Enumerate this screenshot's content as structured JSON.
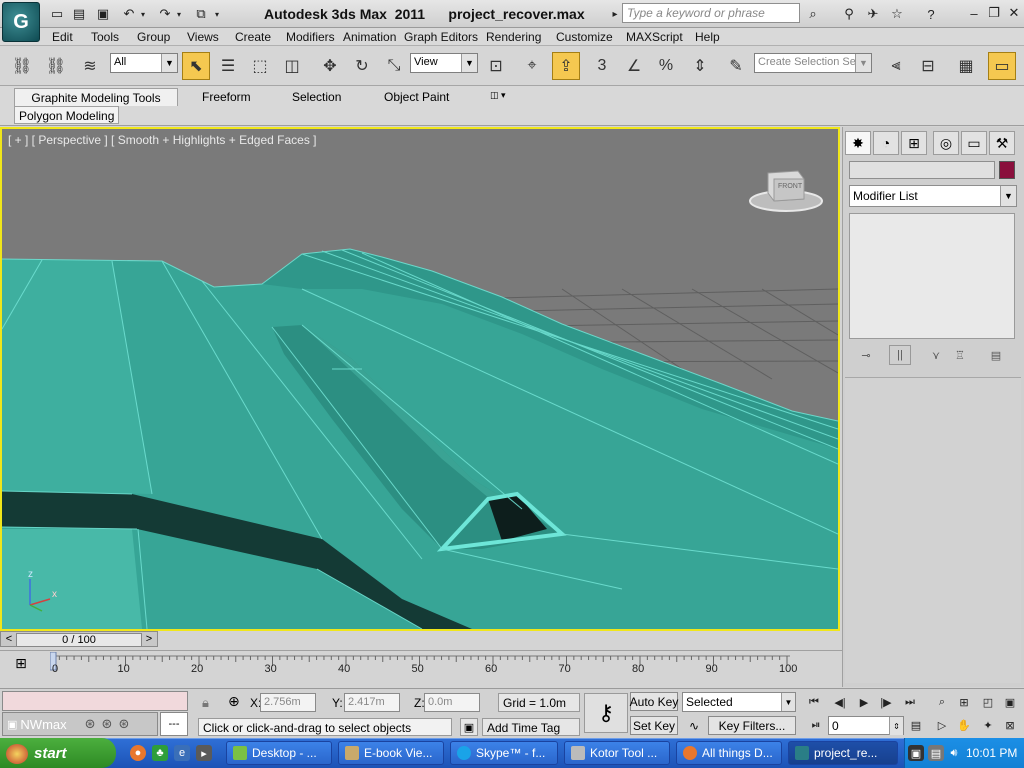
{
  "window": {
    "title": "Autodesk 3ds Max  2011      project_recover.max",
    "search_placeholder": "Type a keyword or phrase"
  },
  "menu": [
    "Edit",
    "Tools",
    "Group",
    "Views",
    "Create",
    "Modifiers",
    "Animation",
    "Graph Editors",
    "Rendering",
    "Customize",
    "MAXScript",
    "Help"
  ],
  "toolbar": {
    "selection_filter": "All",
    "reference_coord": "View",
    "snap_angle_label": "3",
    "named_selection_placeholder": "Create Selection Se"
  },
  "ribbon": {
    "tabs": [
      "Graphite Modeling Tools",
      "Freeform",
      "Selection",
      "Object Paint"
    ],
    "panel_tab": "Polygon Modeling"
  },
  "viewport": {
    "label": "[ + ] [ Perspective ] [ Smooth + Highlights + Edged Faces ]",
    "viewcube_face": "FRONT",
    "axis_x": "x",
    "axis_z": "z"
  },
  "command_panel": {
    "modifier_list": "Modifier List",
    "object_color": "#8a0f3c"
  },
  "time": {
    "slider_label": "0 / 100",
    "ticks": [
      "0",
      "10",
      "20",
      "30",
      "40",
      "50",
      "60",
      "70",
      "80",
      "90",
      "100"
    ]
  },
  "status": {
    "nwmax_label": "NWmax",
    "nwmax_dash": "---",
    "prompt": "Click or click-and-drag to select objects",
    "x_label": "X:",
    "x_value": "2.756m",
    "y_label": "Y:",
    "y_value": "2.417m",
    "z_label": "Z:",
    "z_value": "0.0m",
    "grid": "Grid = 1.0m",
    "add_time_tag": "Add Time Tag",
    "auto_key": "Auto Key",
    "set_key": "Set Key",
    "selected": "Selected",
    "key_filters": "Key Filters...",
    "frame": "0"
  },
  "taskbar": {
    "start": "start",
    "tasks": [
      "Desktop - ...",
      "E-book Vie...",
      "Skype™ - f...",
      "Kotor Tool ...",
      "All things D...",
      "project_re..."
    ],
    "clock": "10:01 PM"
  },
  "colors": {
    "viewport_border": "#f0e61a",
    "mesh": "#3aa99b",
    "taskbar": "#245edb"
  }
}
